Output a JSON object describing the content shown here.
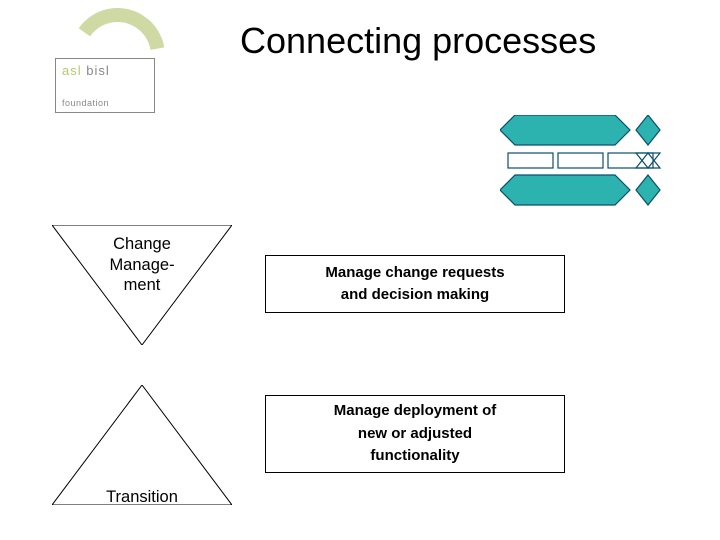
{
  "logo": {
    "line1_asl": "asl",
    "line1_bisl": " bisl",
    "line2": "foundation"
  },
  "title": "Connecting processes",
  "shapes": {
    "change_mgmt": {
      "line1": "Change",
      "line2": "Manage-",
      "line3": "ment"
    },
    "transition": "Transition"
  },
  "boxes": {
    "b1_line1": "Manage change requests",
    "b1_line2": "and decision making",
    "b2_line1": "Manage deployment of",
    "b2_line2": "new or adjusted",
    "b2_line3": "functionality"
  }
}
